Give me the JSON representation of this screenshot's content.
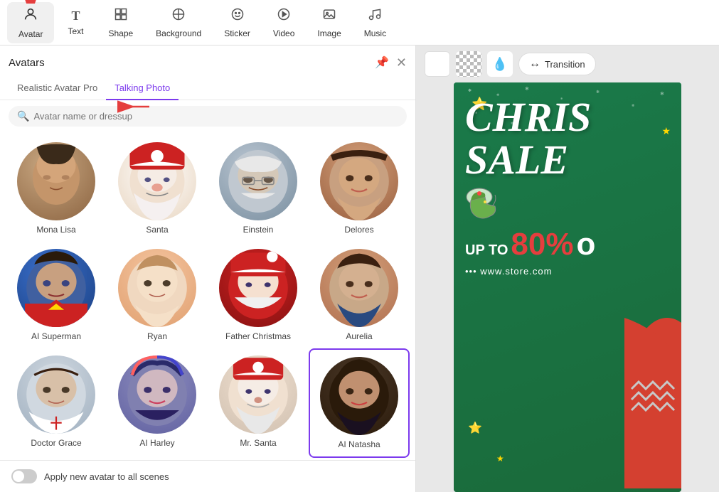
{
  "toolbar": {
    "items": [
      {
        "id": "avatar",
        "label": "Avatar",
        "icon": "👤",
        "active": true
      },
      {
        "id": "text",
        "label": "Text",
        "icon": "T",
        "active": false
      },
      {
        "id": "shape",
        "label": "Shape",
        "icon": "⊞",
        "active": false
      },
      {
        "id": "background",
        "label": "Background",
        "icon": "⊘",
        "active": false
      },
      {
        "id": "sticker",
        "label": "Sticker",
        "icon": "☺",
        "active": false
      },
      {
        "id": "video",
        "label": "Video",
        "icon": "▶",
        "active": false
      },
      {
        "id": "image",
        "label": "Image",
        "icon": "🖼",
        "active": false
      },
      {
        "id": "music",
        "label": "Music",
        "icon": "♩",
        "active": false
      }
    ]
  },
  "panel": {
    "title": "Avatars",
    "tabs": [
      {
        "id": "realistic",
        "label": "Realistic Avatar Pro",
        "active": false
      },
      {
        "id": "talking",
        "label": "Talking Photo",
        "active": true
      }
    ],
    "search": {
      "placeholder": "Avatar name or dressup"
    },
    "avatars": [
      {
        "id": "mona-lisa",
        "name": "Mona Lisa",
        "selected": false
      },
      {
        "id": "santa",
        "name": "Santa",
        "selected": false
      },
      {
        "id": "einstein",
        "name": "Einstein",
        "selected": false
      },
      {
        "id": "delores",
        "name": "Delores",
        "selected": false
      },
      {
        "id": "ai-superman",
        "name": "AI Superman",
        "selected": false
      },
      {
        "id": "ryan",
        "name": "Ryan",
        "selected": false
      },
      {
        "id": "father-christmas",
        "name": "Father Christmas",
        "selected": false
      },
      {
        "id": "aurelia",
        "name": "Aurelia",
        "selected": false
      },
      {
        "id": "doctor-grace",
        "name": "Doctor Grace",
        "selected": false
      },
      {
        "id": "ai-harley",
        "name": "AI Harley",
        "selected": false
      },
      {
        "id": "mr-santa",
        "name": "Mr. Santa",
        "selected": false
      },
      {
        "id": "ai-natasha",
        "name": "AI Natasha",
        "selected": true
      }
    ],
    "bottom": {
      "toggle_label": "Apply new avatar to all scenes",
      "toggle_on": false
    }
  },
  "canvas": {
    "transition_label": "Transition",
    "card": {
      "title_line1": "CHRIS",
      "title_line2": "SALE",
      "discount_text": "UP TO",
      "discount_value": "80%",
      "discount_suffix": "o",
      "url": "••• www.store.com"
    }
  }
}
